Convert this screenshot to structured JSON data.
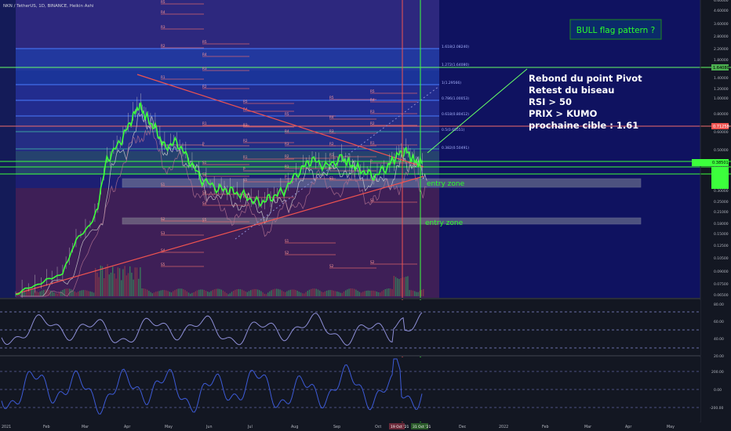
{
  "header": {
    "symbol_line": "NKN / TetherUS, 1D, BINANCE, Heikin Ashi"
  },
  "colors": {
    "background": "#131722",
    "chart_bg": "#13166b",
    "price_line": "#3cff3c",
    "wick": "#c8c8c8",
    "trend": "#ef5350",
    "annotation": "#2bff2b",
    "fib_line": "#4a7bff",
    "pivot_r": "#f06c6c",
    "pivot_s": "#f06c6c"
  },
  "annotations": {
    "bull_flag": "BULL flag pattern ?",
    "notes": [
      "Rebond du point Pivot",
      "Retest du biseau",
      "RSI > 50",
      "PRIX > KUMO",
      "prochaine cible :  1.61"
    ],
    "entry_zone_1": "entry zone",
    "entry_zone_2": "entry zone"
  },
  "fib_labels": [
    "1.618(2.08240)",
    "1.272(1.64080)",
    "1(1.29566)",
    "0.786(1.00053)",
    "0.618(0.80412)",
    "0.5(0.65551)",
    "0.382(0.50491)"
  ],
  "pivot_labels": {
    "left": [
      "R5",
      "R4",
      "R3",
      "R2",
      "R1",
      "P",
      "S1",
      "S2",
      "S3",
      "S4",
      "S5"
    ],
    "mid": [
      "R5",
      "R4",
      "R3",
      "R2",
      "R1",
      "P",
      "S1",
      "S2"
    ],
    "right": [
      "R5",
      "R4",
      "R3",
      "R2",
      "R1",
      "P",
      "S1",
      "S2"
    ]
  },
  "price_axis": [
    "6.60000",
    "4.60000",
    "3.60000",
    "2.80000",
    "2.20000",
    "1.80000",
    "1.40000",
    "1.20000",
    "1.00000",
    "0.80000",
    "0.60000",
    "0.50000",
    "0.40000",
    "0.35000",
    "0.30000",
    "0.25000",
    "0.21000",
    "0.18000",
    "0.15000",
    "0.12500",
    "0.10500",
    "0.09000",
    "0.07500",
    "0.06500"
  ],
  "price_tags": [
    "1.64080",
    "0.71258",
    "0.38501"
  ],
  "rsi_axis": [
    "80.00",
    "60.00",
    "40.00",
    "20.00"
  ],
  "cci_axis": [
    "200.00",
    "0.00",
    "-200.00"
  ],
  "time_axis": [
    "2021",
    "Feb",
    "Mar",
    "Apr",
    "May",
    "Jun",
    "Jul",
    "Aug",
    "Sep",
    "Oct",
    "Nov",
    "Dec",
    "2022",
    "Feb",
    "Mar",
    "Apr",
    "May"
  ],
  "time_markers": [
    "19 Oct '21",
    "31 Oct '21"
  ],
  "chart_data": {
    "type": "line",
    "title": "NKN / TetherUS, 1D, BINANCE, Heikin Ashi",
    "xlabel": "",
    "ylabel": "",
    "log_scale": true,
    "x": [
      "2021-01-01",
      "2021-01-20",
      "2021-02-05",
      "2021-02-15",
      "2021-03-01",
      "2021-03-10",
      "2021-03-20",
      "2021-03-28",
      "2021-04-03",
      "2021-04-08",
      "2021-04-15",
      "2021-04-22",
      "2021-05-01",
      "2021-05-10",
      "2021-05-20",
      "2021-06-01",
      "2021-06-10",
      "2021-06-20",
      "2021-07-01",
      "2021-07-10",
      "2021-07-20",
      "2021-08-01",
      "2021-08-10",
      "2021-08-20",
      "2021-09-01",
      "2021-09-07",
      "2021-09-15",
      "2021-09-25",
      "2021-10-05",
      "2021-10-12",
      "2021-10-19",
      "2021-10-25",
      "2021-10-31"
    ],
    "series": [
      {
        "values": [
          0.05,
          0.06,
          0.07,
          0.12,
          0.17,
          0.45,
          0.6,
          0.85,
          1.1,
          0.9,
          0.75,
          0.55,
          0.6,
          0.45,
          0.32,
          0.28,
          0.27,
          0.25,
          0.22,
          0.24,
          0.27,
          0.38,
          0.45,
          0.4,
          0.46,
          0.42,
          0.38,
          0.34,
          0.4,
          0.48,
          0.52,
          0.44,
          0.42
        ]
      }
    ]
  }
}
